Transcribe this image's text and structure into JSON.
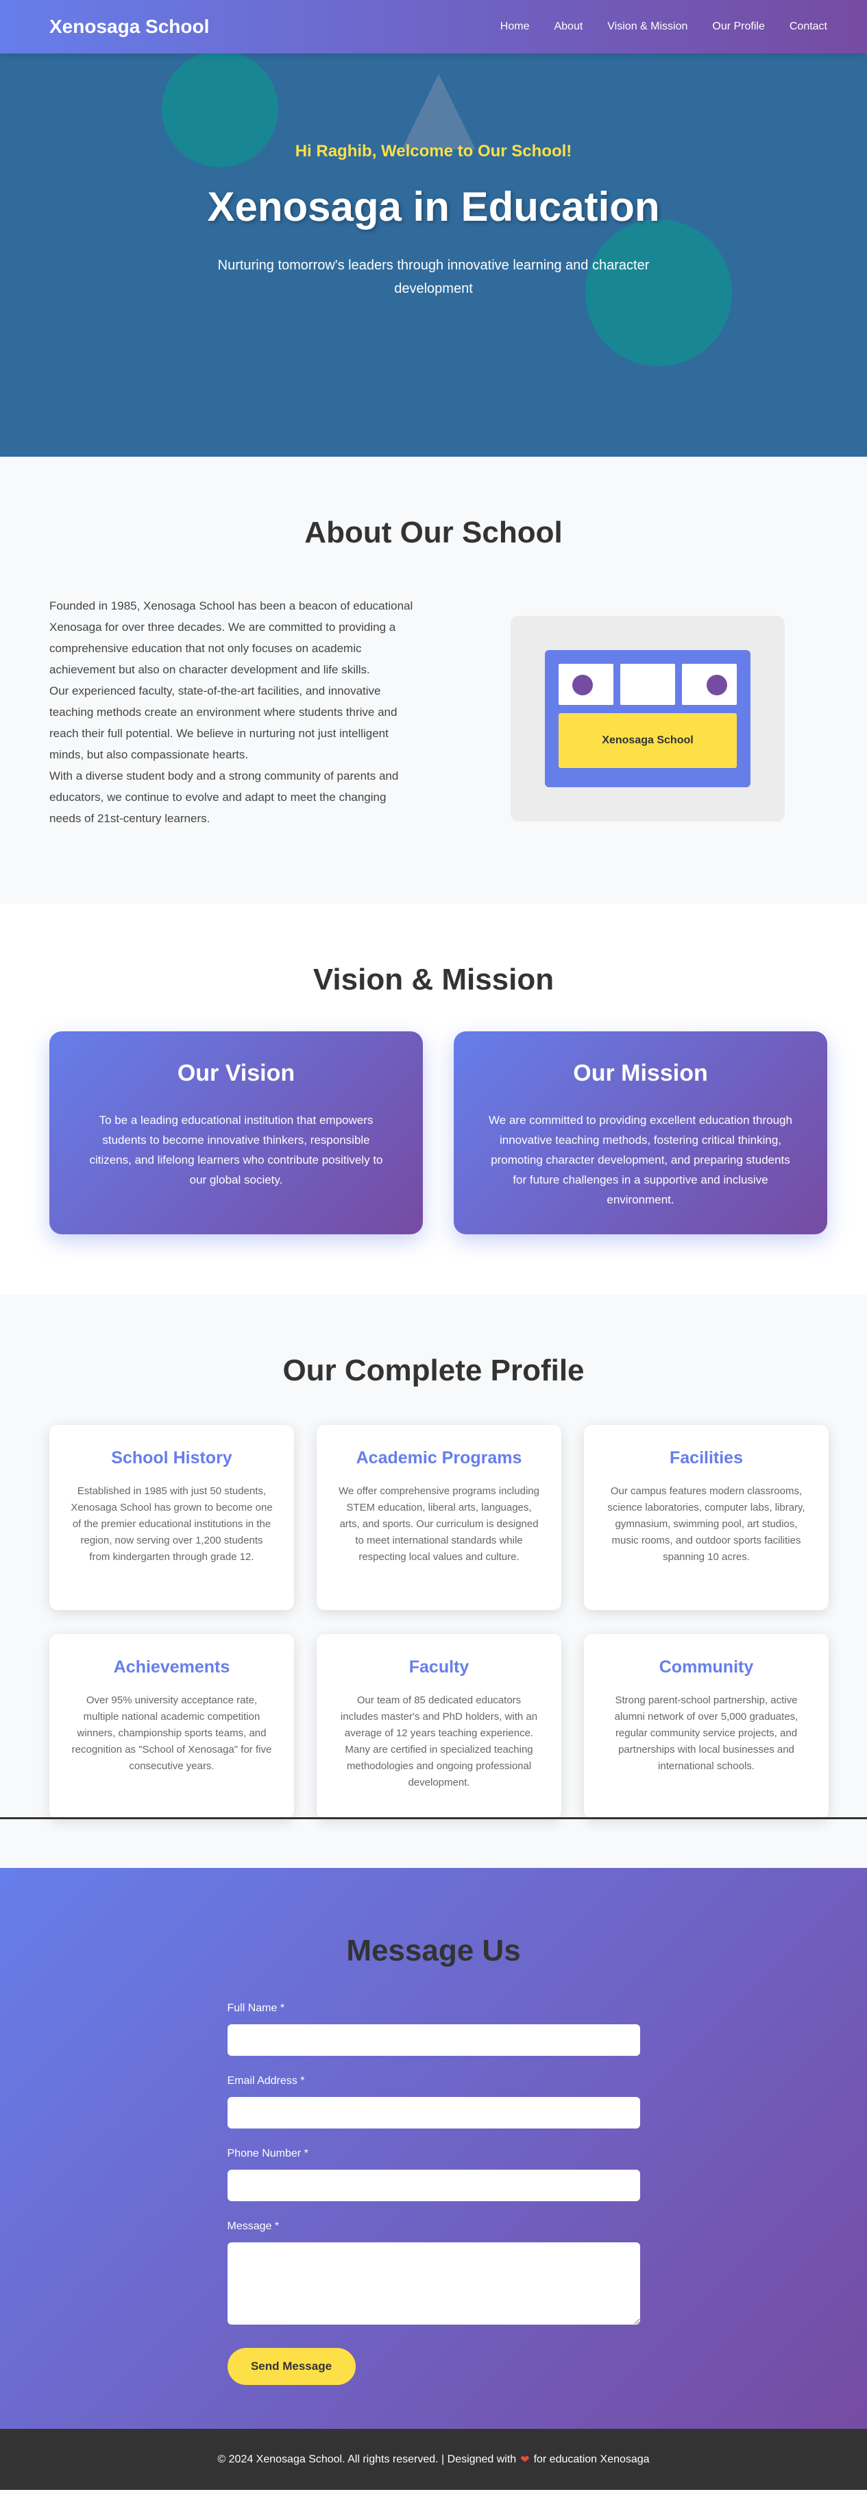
{
  "nav": {
    "brand": "Xenosaga School",
    "links": [
      "Home",
      "About",
      "Vision & Mission",
      "Our Profile",
      "Contact"
    ]
  },
  "hero": {
    "welcome": "Hi Raghib, Welcome to Our School!",
    "title": "Xenosaga in Education",
    "subtitle": "Nurturing tomorrow's leaders through innovative learning and character development"
  },
  "about": {
    "title": "About Our School",
    "paragraphs": [
      "Founded in 1985, Xenosaga School has been a beacon of educational Xenosaga for over three decades. We are committed to providing a comprehensive education that not only focuses on academic achievement but also on character development and life skills.",
      "Our experienced faculty, state-of-the-art facilities, and innovative teaching methods create an environment where students thrive and reach their full potential. We believe in nurturing not just intelligent minds, but also compassionate hearts.",
      "With a diverse student body and a strong community of parents and educators, we continue to evolve and adapt to meet the changing needs of 21st-century learners."
    ],
    "sign": "Xenosaga School"
  },
  "vision": {
    "title": "Vision & Mission",
    "vision_title": "Our Vision",
    "vision_text": "To be a leading educational institution that empowers students to become innovative thinkers, responsible citizens, and lifelong learners who contribute positively to our global society.",
    "mission_title": "Our Mission",
    "mission_text": "We are committed to providing excellent education through innovative teaching methods, fostering critical thinking, promoting character development, and preparing students for future challenges in a supportive and inclusive environment."
  },
  "profile": {
    "title": "Our Complete Profile",
    "cards": [
      {
        "title": "School History",
        "text": "Established in 1985 with just 50 students, Xenosaga School has grown to become one of the premier educational institutions in the region, now serving over 1,200 students from kindergarten through grade 12."
      },
      {
        "title": "Academic Programs",
        "text": "We offer comprehensive programs including STEM education, liberal arts, languages, arts, and sports. Our curriculum is designed to meet international standards while respecting local values and culture."
      },
      {
        "title": "Facilities",
        "text": "Our campus features modern classrooms, science laboratories, computer labs, library, gymnasium, swimming pool, art studios, music rooms, and outdoor sports facilities spanning 10 acres."
      },
      {
        "title": "Achievements",
        "text": "Over 95% university acceptance rate, multiple national academic competition winners, championship sports teams, and recognition as \"School of Xenosaga\" for five consecutive years."
      },
      {
        "title": "Faculty",
        "text": "Our team of 85 dedicated educators includes master's and PhD holders, with an average of 12 years teaching experience. Many are certified in specialized teaching methodologies and ongoing professional development."
      },
      {
        "title": "Community",
        "text": "Strong parent-school partnership, active alumni network of over 5,000 graduates, regular community service projects, and partnerships with local businesses and international schools."
      }
    ]
  },
  "contact": {
    "title": "Message Us",
    "name_label": "Full Name *",
    "email_label": "Email Address *",
    "phone_label": "Phone Number *",
    "message_label": "Message *",
    "send_label": "Send Message"
  },
  "footer": {
    "text_before": "© 2024 Xenosaga School. All rights reserved. | Designed with",
    "heart": "❤",
    "text_after": "for education Xenosaga"
  },
  "colors": {
    "primary": "#667eea",
    "secondary": "#764ba2",
    "accent": "#fde047",
    "hero_bg": "#306b9c"
  }
}
